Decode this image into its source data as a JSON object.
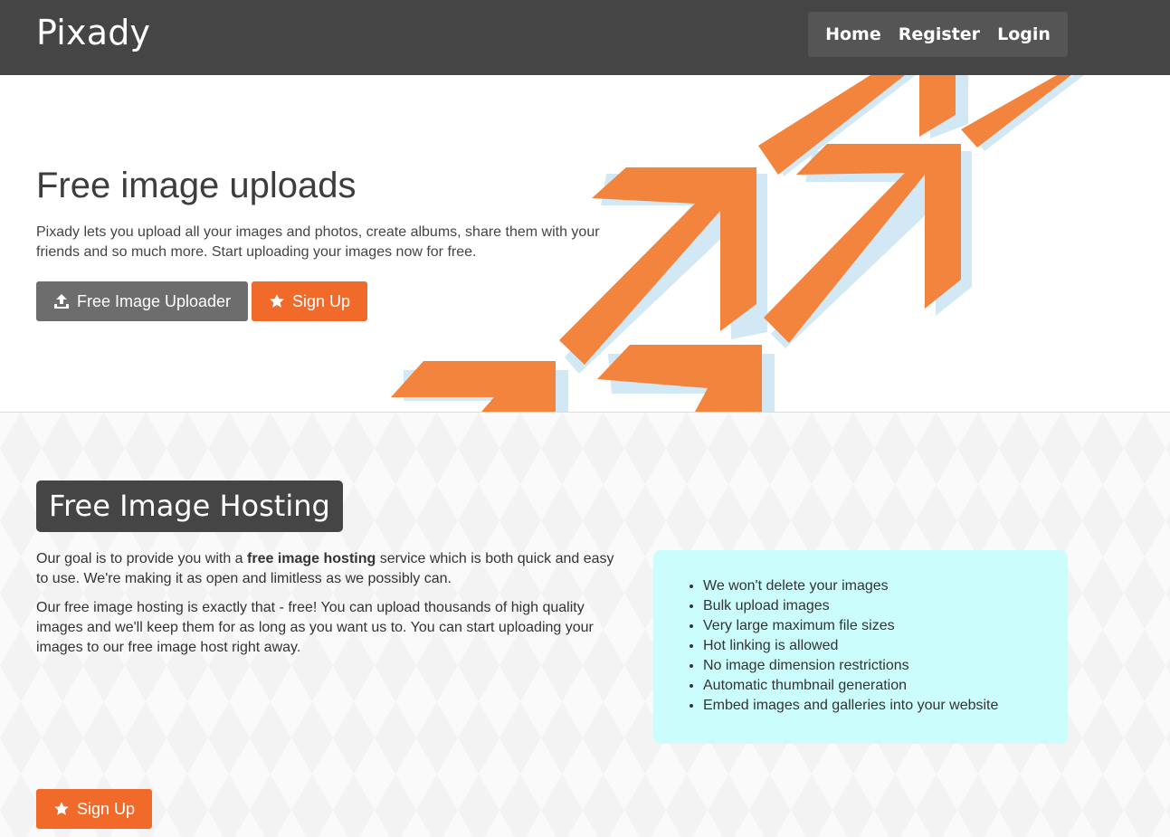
{
  "brand": "Pixady",
  "nav": {
    "home": "Home",
    "register": "Register",
    "login": "Login"
  },
  "hero": {
    "title": "Free image uploads",
    "text": "Pixady lets you upload all your images and photos, create albums, share them with your friends and so much more. Start uploading your images now for free.",
    "uploader_button": "Free Image Uploader",
    "signup_button": "Sign Up"
  },
  "hosting": {
    "title": "Free Image Hosting",
    "p1_before": "Our goal is to provide you with a ",
    "p1_bold": "free image hosting",
    "p1_after": " service which is both quick and easy to use. We're making it as open and limitless as we possibly can.",
    "p2": "Our free image hosting is exactly that - free! You can upload thousands of high quality images and we'll keep them for as long as you want us to. You can start uploading your images to our free image host right away.",
    "features": [
      "We won't delete your images",
      "Bulk upload images",
      "Very large maximum file sizes",
      "Hot linking is allowed",
      "No image dimension restrictions",
      "Automatic thumbnail generation",
      "Embed images and galleries into your website"
    ],
    "signup_button": "Sign Up"
  },
  "colors": {
    "nav_bg": "#454545",
    "accent_orange": "#f26a2a",
    "arrow_orange": "#f2843d",
    "arrow_shadow": "#d3e8f5",
    "feature_box": "#ccfdfd"
  },
  "icons": {
    "upload": "upload-icon",
    "star": "star-icon"
  }
}
